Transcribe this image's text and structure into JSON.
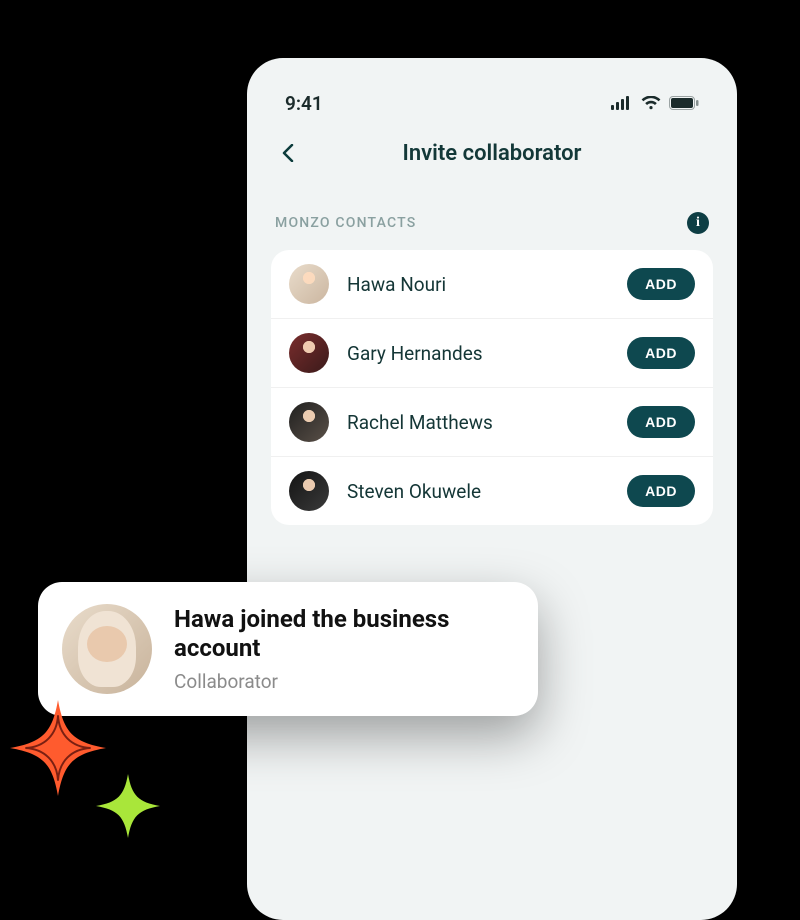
{
  "statusbar": {
    "time": "9:41"
  },
  "header": {
    "title": "Invite collaborator"
  },
  "section": {
    "label": "MONZO CONTACTS"
  },
  "add_label": "ADD",
  "contacts": [
    {
      "name": "Hawa Nouri"
    },
    {
      "name": "Gary Hernandes"
    },
    {
      "name": "Rachel Matthews"
    },
    {
      "name": "Steven Okuwele"
    }
  ],
  "toast": {
    "title": "Hawa joined the business account",
    "subtitle": "Collaborator"
  },
  "colors": {
    "accent": "#0e484f",
    "background": "#f1f4f4"
  }
}
